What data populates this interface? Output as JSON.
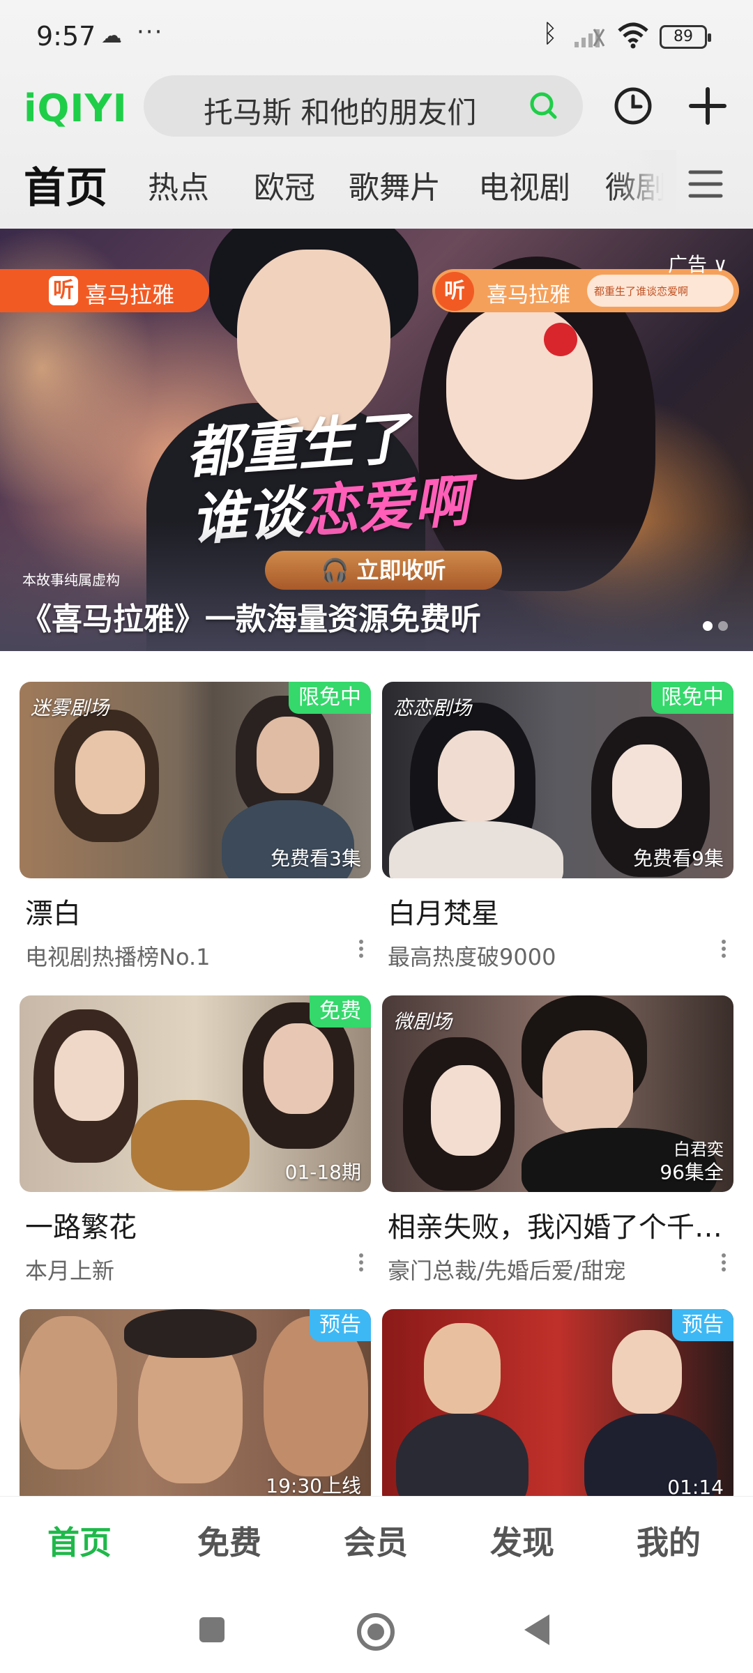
{
  "status_bar": {
    "time": "9:57",
    "dots": "···",
    "battery": "89"
  },
  "header": {
    "logo": "iQIYI",
    "search_placeholder": "托马斯 和他的朋友们"
  },
  "tabs": [
    "首页",
    "热点",
    "欧冠",
    "歌舞片",
    "电视剧",
    "微剧"
  ],
  "banner": {
    "ad_brand": "喜马拉雅",
    "ad_brand_2": "喜马拉雅",
    "ad_search": "都重生了谁谈恋爱啊",
    "ad_label": "广告 ∨",
    "slogan_line1": "都重生了",
    "slogan_line2_a": "谁谈",
    "slogan_line2_b": "恋爱啊",
    "listen_button": "立即收听",
    "disclaimer": "本故事纯属虚构",
    "title": "《喜马拉雅》一款海量资源免费听",
    "page_dots": 2,
    "current_page": 1
  },
  "cards": [
    {
      "title": "漂白",
      "subtitle": "电视剧热播榜No.1",
      "badge": "限免中",
      "overlay": "免费看3集",
      "brand": "迷雾剧场"
    },
    {
      "title": "白月梵星",
      "subtitle": "最高热度破9000",
      "badge": "限免中",
      "overlay": "免费看9集",
      "brand": "恋恋剧场"
    },
    {
      "title": "一路繁花",
      "subtitle": "本月上新",
      "badge": "免费",
      "overlay": "01-18期",
      "brand": ""
    },
    {
      "title": "相亲失败，我闪婚了个千…",
      "subtitle": "豪门总裁/先婚后爱/甜宠",
      "badge": "",
      "overlay": "96集全",
      "overlay_top": "白君奕",
      "brand": "微剧场"
    },
    {
      "title": "",
      "subtitle": "",
      "badge": "预告",
      "overlay": "19:30上线",
      "brand": ""
    },
    {
      "title": "",
      "subtitle": "",
      "badge": "预告",
      "overlay": "01:14",
      "brand": ""
    }
  ],
  "bottom_nav": [
    "首页",
    "免费",
    "会员",
    "发现",
    "我的"
  ],
  "colors": {
    "brand_green": "#1fce48",
    "badge_green": "#34d86b",
    "badge_blue": "#3db8f5",
    "ad_orange": "#f25a23"
  }
}
